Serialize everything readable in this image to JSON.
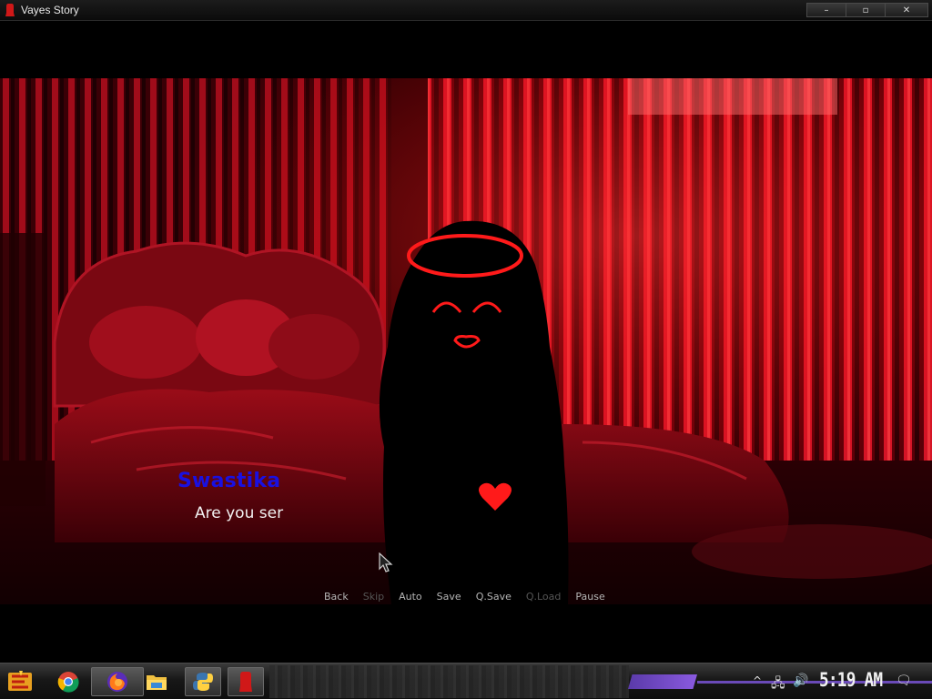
{
  "window": {
    "title": "Vayes Story",
    "minimize_glyph": "–",
    "maximize_glyph": "▫",
    "close_glyph": "✕"
  },
  "dialogue": {
    "speaker": "Swastika",
    "text": "Are you ser"
  },
  "quick_menu": [
    {
      "label": "Back",
      "enabled": true
    },
    {
      "label": "Skip",
      "enabled": false
    },
    {
      "label": "Auto",
      "enabled": true
    },
    {
      "label": "Save",
      "enabled": true
    },
    {
      "label": "Q.Save",
      "enabled": true
    },
    {
      "label": "Q.Load",
      "enabled": false
    },
    {
      "label": "Pause",
      "enabled": true
    }
  ],
  "taskbar": {
    "apps": [
      "start-icon",
      "chrome-icon",
      "firefox-icon",
      "file-explorer-icon",
      "python-icon",
      "vayes-story-icon"
    ],
    "clock": "5:19 AM",
    "tray_up_glyph": "^",
    "tray_network_glyph": "🖧",
    "tray_volume_glyph": "🔊",
    "tray_notification_glyph": "🗨"
  },
  "colors": {
    "speaker_name": "#1a10e0",
    "character_glow": "#ff1a1a",
    "scene_red": "#b00010"
  }
}
